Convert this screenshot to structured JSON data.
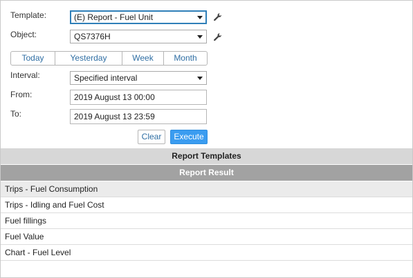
{
  "form": {
    "template_label": "Template:",
    "template_value": "(E) Report - Fuel Unit",
    "object_label": "Object:",
    "object_value": "QS7376H",
    "interval_label": "Interval:",
    "interval_value": "Specified interval",
    "from_label": "From:",
    "from_value": "2019 August 13 00:00",
    "to_label": "To:",
    "to_value": "2019 August 13 23:59"
  },
  "periods": [
    "Today",
    "Yesterday",
    "Week",
    "Month"
  ],
  "actions": {
    "clear_label": "Clear",
    "execute_label": "Execute"
  },
  "sections": {
    "templates_label": "Report Templates",
    "result_label": "Report Result"
  },
  "reports": [
    "Trips - Fuel Consumption",
    "Trips - Idling and Fuel Cost",
    "Fuel fillings",
    "Fuel Value",
    "Chart - Fuel Level"
  ],
  "colors": {
    "execute_bg": "#3a9cf0",
    "link": "#2f6ea3",
    "templates_header_bg": "#d7d7d7",
    "result_header_bg": "#a2a2a2"
  },
  "icons": {
    "template_settings": "wrench-icon",
    "object_settings": "wrench-icon",
    "dropdown": "chevron-down-icon"
  }
}
